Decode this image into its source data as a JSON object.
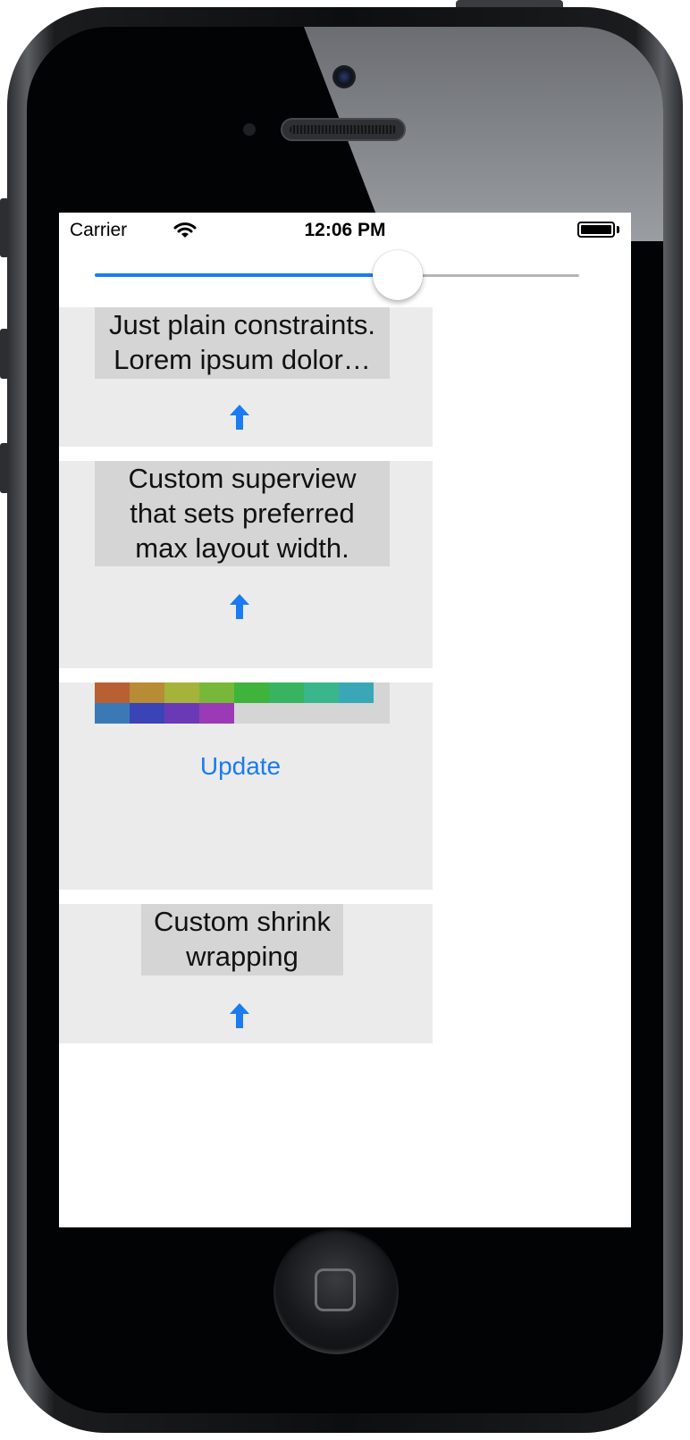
{
  "status_bar": {
    "carrier": "Carrier",
    "time": "12:06 PM",
    "wifi_icon": "wifi-icon",
    "battery_icon": "battery-icon"
  },
  "slider": {
    "value": 0.64
  },
  "cells": {
    "plain": {
      "label": "Just plain constraints. Lorem ipsum dolor…",
      "line1": "Just plain constraints.",
      "line2": "Lorem ipsum dolor…",
      "icon": "arrow-up-icon"
    },
    "custom_superview": {
      "line1": "Custom superview",
      "line2": "that sets preferred",
      "line3": "max layout width.",
      "icon": "arrow-up-icon"
    },
    "color_grid": {
      "swatch_colors": [
        "#b85f34",
        "#b88b35",
        "#a6b33a",
        "#77b83a",
        "#40b33c",
        "#38b461",
        "#3ab68c",
        "#3aa7b6",
        "#3a79b6",
        "#3a44b6",
        "#6a3ab6",
        "#9a3ab6"
      ],
      "button_label": "Update"
    },
    "shrink_wrap": {
      "line1": "Custom shrink",
      "line2": "wrapping",
      "icon": "arrow-up-icon"
    }
  },
  "colors": {
    "accent": "#1a7cf0",
    "cell_background": "#ebebeb",
    "label_background": "#d5d5d5"
  }
}
